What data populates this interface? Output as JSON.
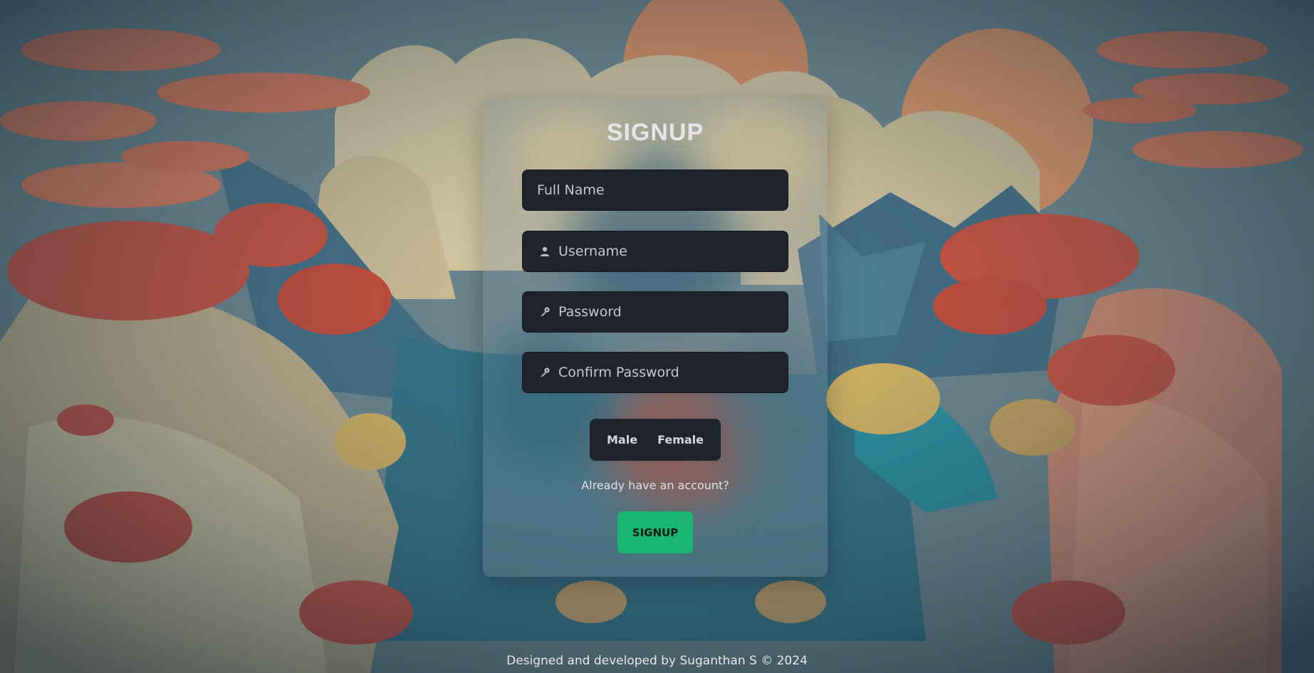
{
  "form": {
    "title": "SIGNUP",
    "fields": [
      {
        "placeholder": "Full Name",
        "icon": "none"
      },
      {
        "placeholder": "Username",
        "icon": "user-icon"
      },
      {
        "placeholder": "Password",
        "icon": "key-icon"
      },
      {
        "placeholder": "Confirm Password",
        "icon": "key-icon"
      }
    ],
    "gender": {
      "options": [
        "Male",
        "Female"
      ]
    },
    "login_link": "Already have an account?",
    "submit_label": "SIGNUP"
  },
  "footer": {
    "text": "Designed and developed by Suganthan S © 2024"
  },
  "colors": {
    "accent_green": "#19b672",
    "field_bg": "#1f242c",
    "title_text": "#e4e6ea"
  }
}
